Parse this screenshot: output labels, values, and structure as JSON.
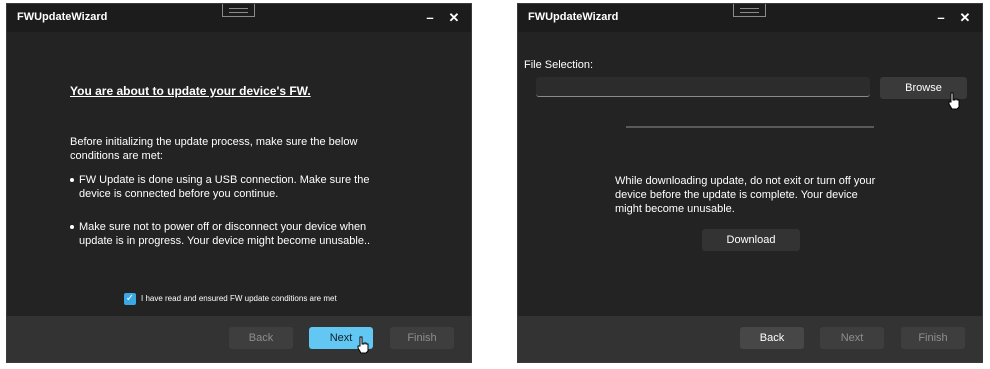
{
  "colors": {
    "window_bg": "#232323",
    "titlebar_bg": "#1c1c1c",
    "footer_bg": "#333333",
    "primary_button": "#62c8f3",
    "checkbox_accent": "#3aa7e6"
  },
  "icons": [
    "minimize-icon",
    "close-icon",
    "window-grip-icon",
    "checkmark-icon",
    "hand-pointer-icon"
  ],
  "window1": {
    "title": "FWUpdateWizard",
    "minimize": "–",
    "close": "✕",
    "heading": "You are about to update your device's FW.",
    "intro": "Before initializing the update process, make sure the below conditions are met:",
    "bullets": [
      "FW Update is done using a USB connection. Make sure the device is connected before you continue.",
      "Make sure not to power off or disconnect your device when update is in progress. Your device might become unusable.."
    ],
    "checkbox": {
      "checked": true,
      "label": "I have read and ensured FW update conditions are met"
    },
    "footer": {
      "back": "Back",
      "next": "Next",
      "finish": "Finish"
    }
  },
  "window2": {
    "title": "FWUpdateWizard",
    "minimize": "–",
    "close": "✕",
    "file_label": "File Selection:",
    "file_value": "",
    "browse": "Browse",
    "progress": 0,
    "warning": "While downloading update, do not exit or turn off your device before the update is complete. Your device might become unusable.",
    "download": "Download",
    "footer": {
      "back": "Back",
      "next": "Next",
      "finish": "Finish"
    }
  }
}
